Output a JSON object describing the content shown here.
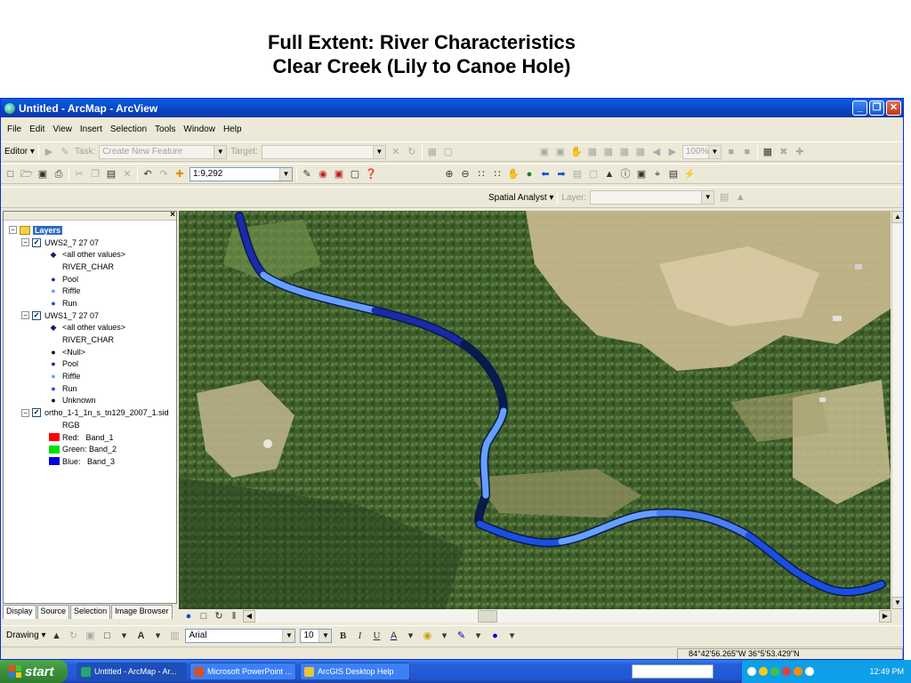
{
  "slide": {
    "title_line1": "Full Extent: River Characteristics",
    "title_line2": "Clear Creek (Lily to Canoe Hole)"
  },
  "window": {
    "title": "Untitled - ArcMap - ArcView",
    "controls": {
      "minimize": "_",
      "maximize": "❐",
      "close": "✕"
    }
  },
  "menu": [
    "File",
    "Edit",
    "View",
    "Insert",
    "Selection",
    "Tools",
    "Window",
    "Help"
  ],
  "editor_toolbar": {
    "editor_label": "Editor ▾",
    "task_label": "Task:",
    "task_value": "Create New Feature",
    "target_label": "Target:",
    "target_value": "",
    "zoom_value": "100%"
  },
  "standard_toolbar": {
    "scale_value": "1:9,292"
  },
  "spatial_toolbar": {
    "spatial_analyst_label": "Spatial Analyst ▾",
    "layer_label": "Layer:",
    "layer_value": ""
  },
  "toc": {
    "close_label": "×",
    "root_label": "Layers",
    "layers": [
      {
        "name": "UWS2_7 27 07",
        "checked": "✓",
        "items": [
          {
            "sym": "◆",
            "color": "#1a1a6a",
            "label": "<all other values>"
          },
          {
            "sym": "",
            "color": "",
            "label": "RIVER_CHAR"
          },
          {
            "sym": "●",
            "color": "#1b2aa8",
            "label": "Pool"
          },
          {
            "sym": "●",
            "color": "#66a0ff",
            "label": "Riffle"
          },
          {
            "sym": "●",
            "color": "#1b4fe0",
            "label": "Run"
          }
        ]
      },
      {
        "name": "UWS1_7 27 07",
        "checked": "✓",
        "items": [
          {
            "sym": "◆",
            "color": "#1a1a6a",
            "label": "<all other values>"
          },
          {
            "sym": "",
            "color": "",
            "label": "RIVER_CHAR"
          },
          {
            "sym": "●",
            "color": "#000000",
            "label": "<Null>"
          },
          {
            "sym": "●",
            "color": "#1b2aa8",
            "label": "Pool"
          },
          {
            "sym": "●",
            "color": "#66a0ff",
            "label": "Riffle"
          },
          {
            "sym": "●",
            "color": "#1b4fe0",
            "label": "Run"
          },
          {
            "sym": "●",
            "color": "#000000",
            "label": "Unknown"
          }
        ]
      },
      {
        "name": "ortho_1-1_1n_s_tn129_2007_1.sid",
        "checked": "✓",
        "items": [
          {
            "label": "RGB"
          },
          {
            "swatch": "#ff0000",
            "label": "Red:   Band_1"
          },
          {
            "swatch": "#00e000",
            "label": "Green: Band_2"
          },
          {
            "swatch": "#0000e0",
            "label": "Blue:   Band_3"
          }
        ]
      }
    ],
    "tabs": [
      "Display",
      "Source",
      "Selection",
      "Image Browser"
    ]
  },
  "drawing_toolbar": {
    "drawing_label": "Drawing ▾",
    "font_value": "Arial",
    "size_value": "10",
    "bold": "B",
    "italic": "I",
    "underline": "U",
    "font_color": "A"
  },
  "status": {
    "coords": "84°42'56.265\"W  36°5'53.429\"N"
  },
  "taskbar": {
    "start_label": "start",
    "tasks": [
      {
        "label": "Untitled - ArcMap - Ar...",
        "color": "#2aa56a"
      },
      {
        "label": "Microsoft PowerPoint ...",
        "color": "#d2522a"
      },
      {
        "label": "ArcGIS Desktop Help",
        "color": "#e8c43a"
      }
    ],
    "clock": "12:49 PM"
  },
  "colors": {
    "pool": "#1b2aa8",
    "riffle": "#66a0ff",
    "run": "#1b4fe0",
    "xp_blue": "#0a5fe0"
  }
}
